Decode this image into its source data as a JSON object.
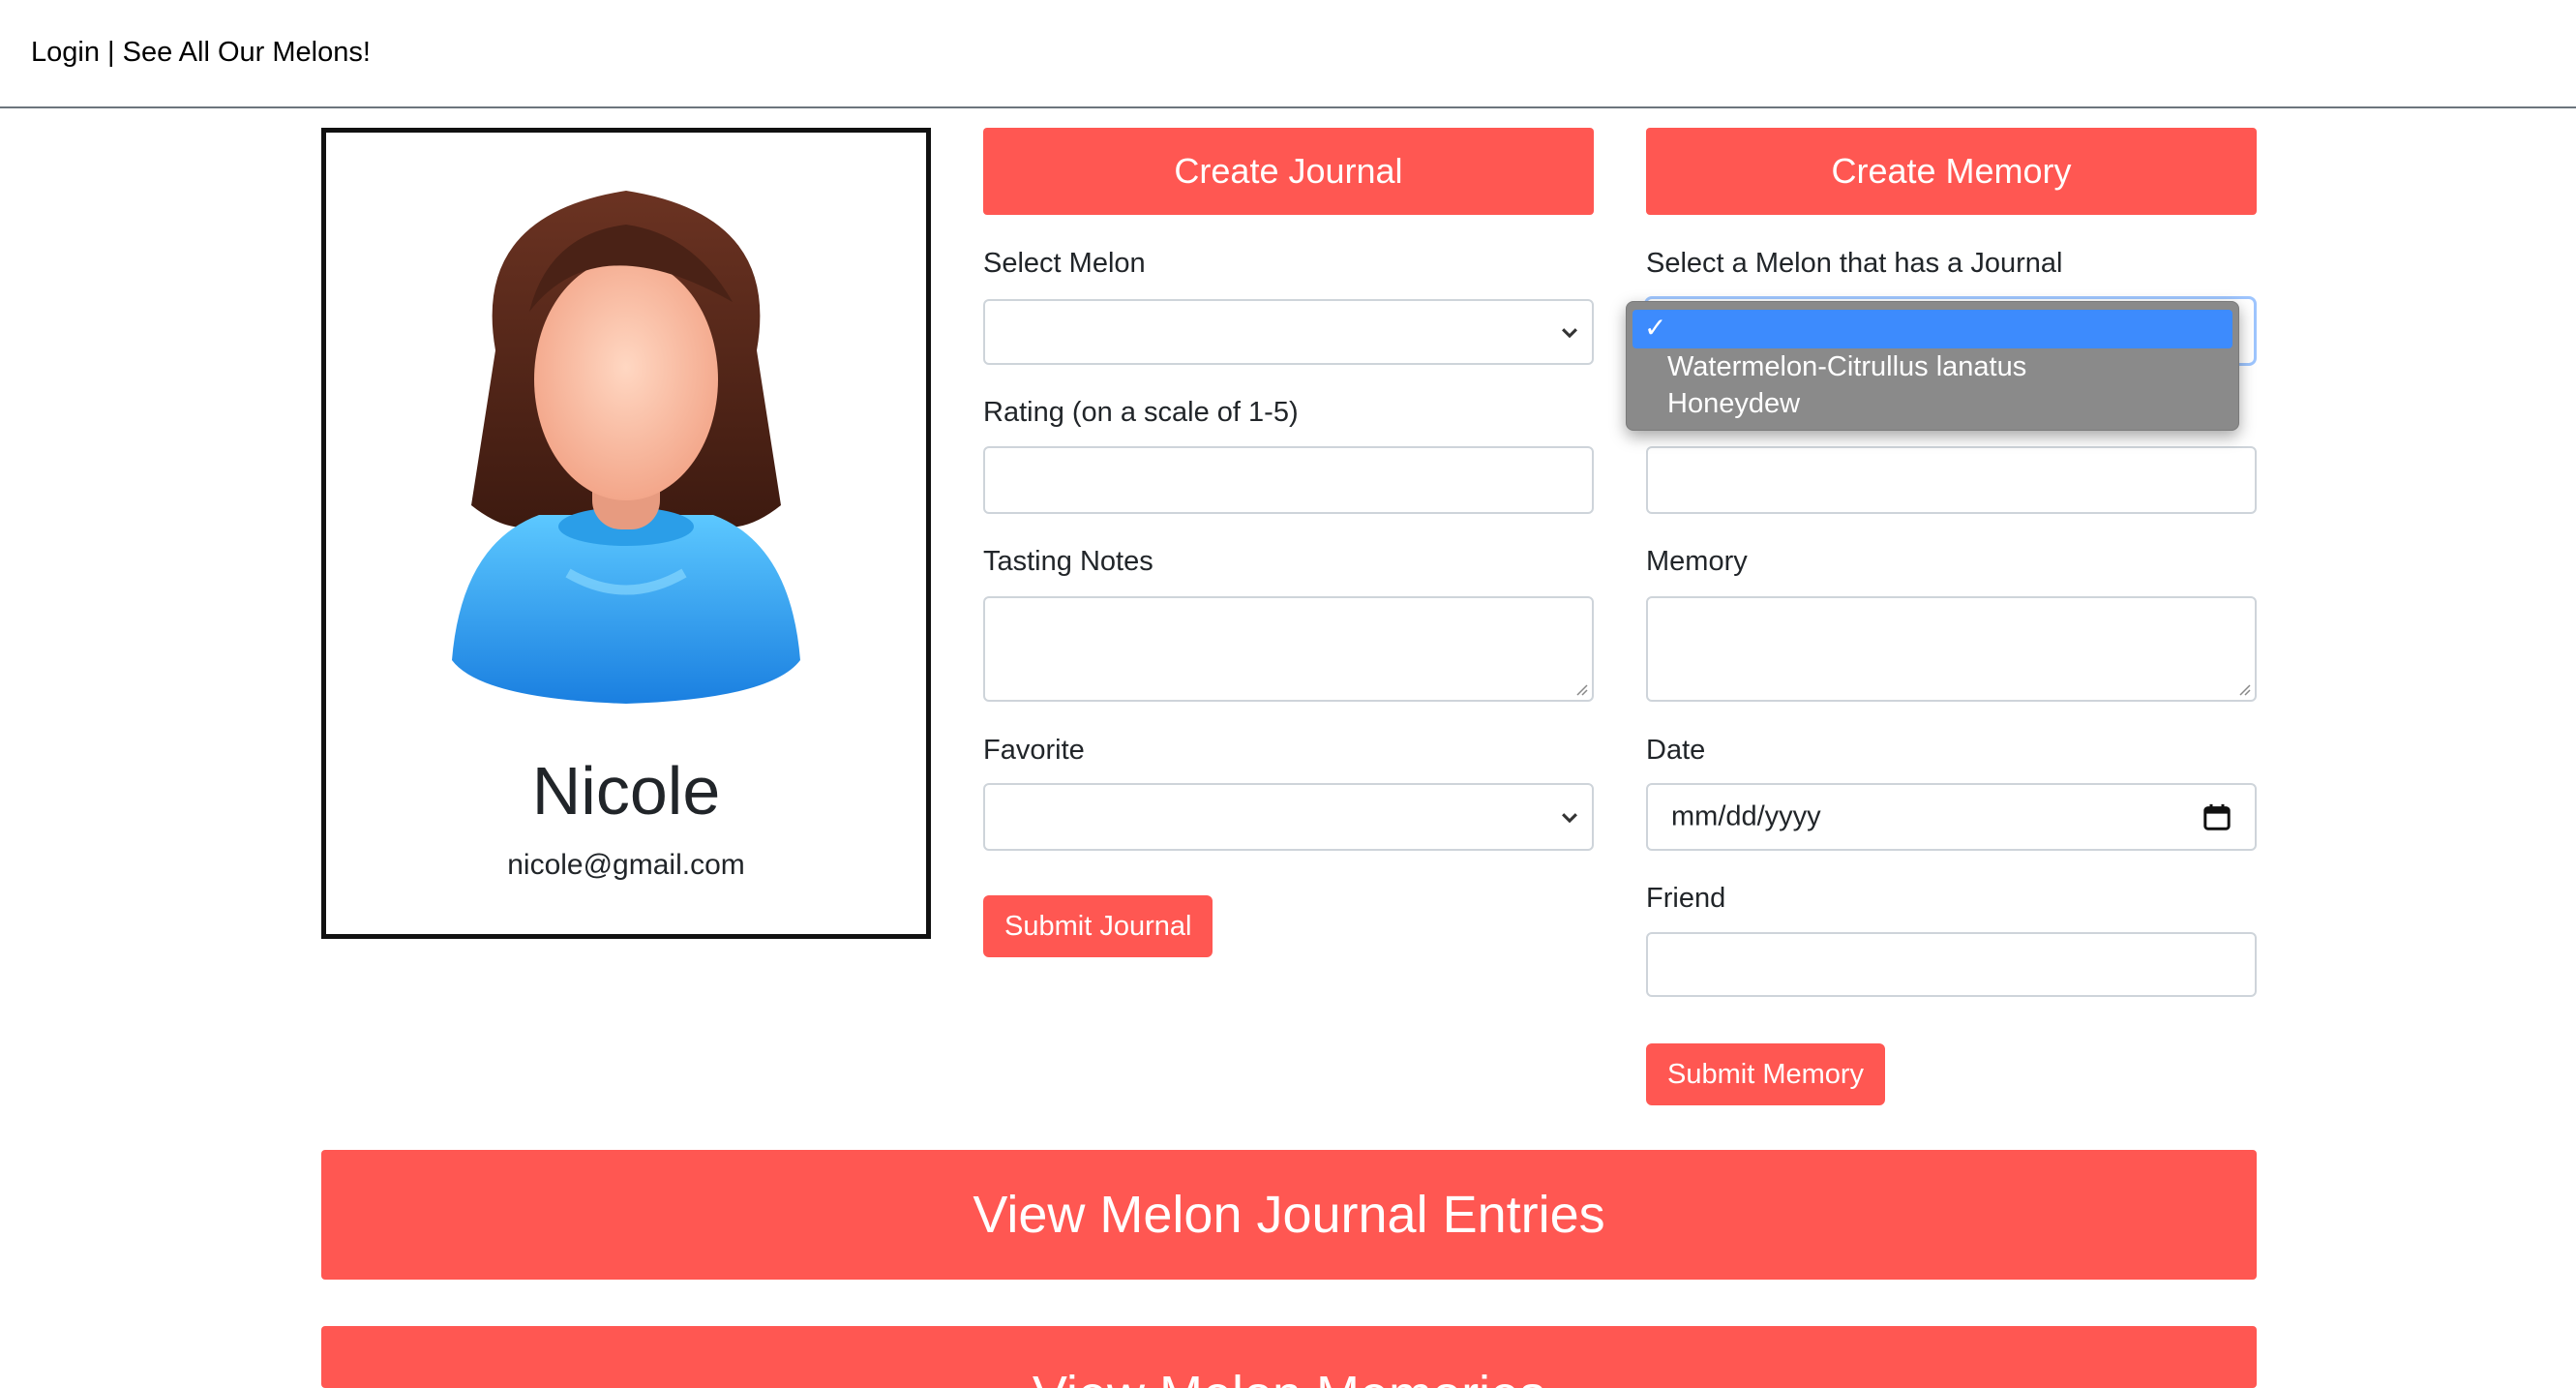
{
  "nav": {
    "login": "Login",
    "separator": " | ",
    "see_melons": "See All Our Melons!"
  },
  "profile": {
    "name": "Nicole",
    "email": "nicole@gmail.com"
  },
  "journal": {
    "header": "Create Journal",
    "select_melon_label": "Select Melon",
    "rating_label": "Rating (on a scale of 1-5)",
    "tasting_notes_label": "Tasting Notes",
    "favorite_label": "Favorite",
    "submit": "Submit Journal"
  },
  "memory": {
    "header": "Create Memory",
    "select_label": "Select a Melon that has a Journal",
    "memory_label": "Memory",
    "date_label": "Date",
    "date_placeholder": "mm/dd/yyyy",
    "friend_label": "Friend",
    "submit": "Submit Memory",
    "dropdown_options": [
      "Watermelon-Citrullus lanatus",
      "Honeydew"
    ]
  },
  "actions": {
    "view_journal": "View Melon Journal Entries",
    "view_memories": "View Melon Memories"
  },
  "colors": {
    "accent": "#ff5752",
    "dropdown_bg": "#8a8a8a",
    "selection": "#3d8bfd"
  }
}
